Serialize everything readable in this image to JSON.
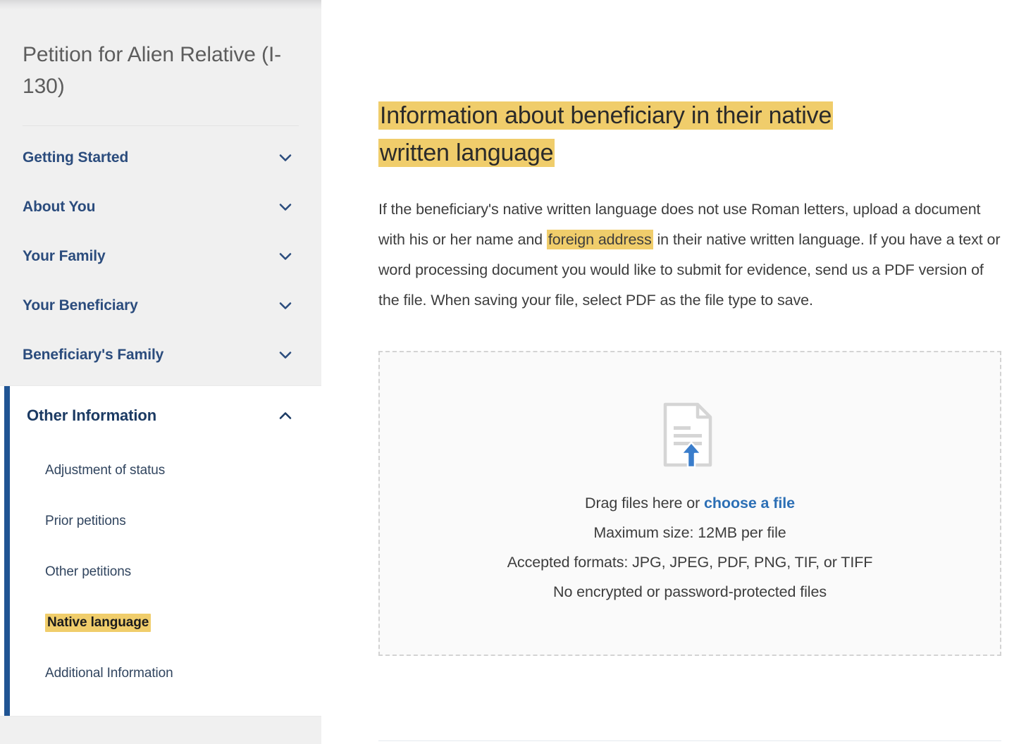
{
  "sidebar": {
    "title": "Petition for Alien Relative (I-130)",
    "nav_items": [
      {
        "label": "Getting Started",
        "icon": "chevron-down-icon",
        "expanded": false
      },
      {
        "label": "About You",
        "icon": "chevron-down-icon",
        "expanded": false
      },
      {
        "label": "Your Family",
        "icon": "chevron-down-icon",
        "expanded": false
      },
      {
        "label": "Your Beneficiary",
        "icon": "chevron-down-icon",
        "expanded": false
      },
      {
        "label": "Beneficiary's Family",
        "icon": "chevron-down-icon",
        "expanded": false
      }
    ],
    "expanded_group": {
      "label": "Other Information",
      "icon": "chevron-up-icon",
      "expanded": true,
      "accent_color": "#205493",
      "sub_items": [
        {
          "label": "Adjustment of status",
          "current": false
        },
        {
          "label": "Prior petitions",
          "current": false
        },
        {
          "label": "Other petitions",
          "current": false
        },
        {
          "label": "Native language",
          "current": true
        },
        {
          "label": "Additional Information",
          "current": false
        }
      ]
    }
  },
  "main": {
    "heading_line1": "Information about beneficiary in their native",
    "heading_line2": "written language",
    "body_part1": "If the beneficiary's native written language does not use Roman letters, upload a document with his or her name and ",
    "body_highlight": "foreign address",
    "body_part2": " in their native written language. If you have a text or word processing document you would like to submit for evidence, send us a PDF version of the file. When saving your file, select PDF as the file type to save.",
    "dropzone": {
      "icon": "file-upload-icon",
      "drag_text": "Drag files here or ",
      "choose_link": "choose a file",
      "max_size": "Maximum size: 12MB per file",
      "accepted_formats": "Accepted formats: JPG, JPEG, PDF, PNG, TIF, or TIFF",
      "encryption_note": "No encrypted or password-protected files"
    }
  },
  "colors": {
    "highlight_yellow": "#f0cd6b",
    "nav_blue": "#2b4c7d",
    "accent_blue": "#205493",
    "link_blue": "#2c6fb5",
    "sidebar_bg": "#f0f0f0",
    "dropzone_border": "#d3d3d3"
  }
}
